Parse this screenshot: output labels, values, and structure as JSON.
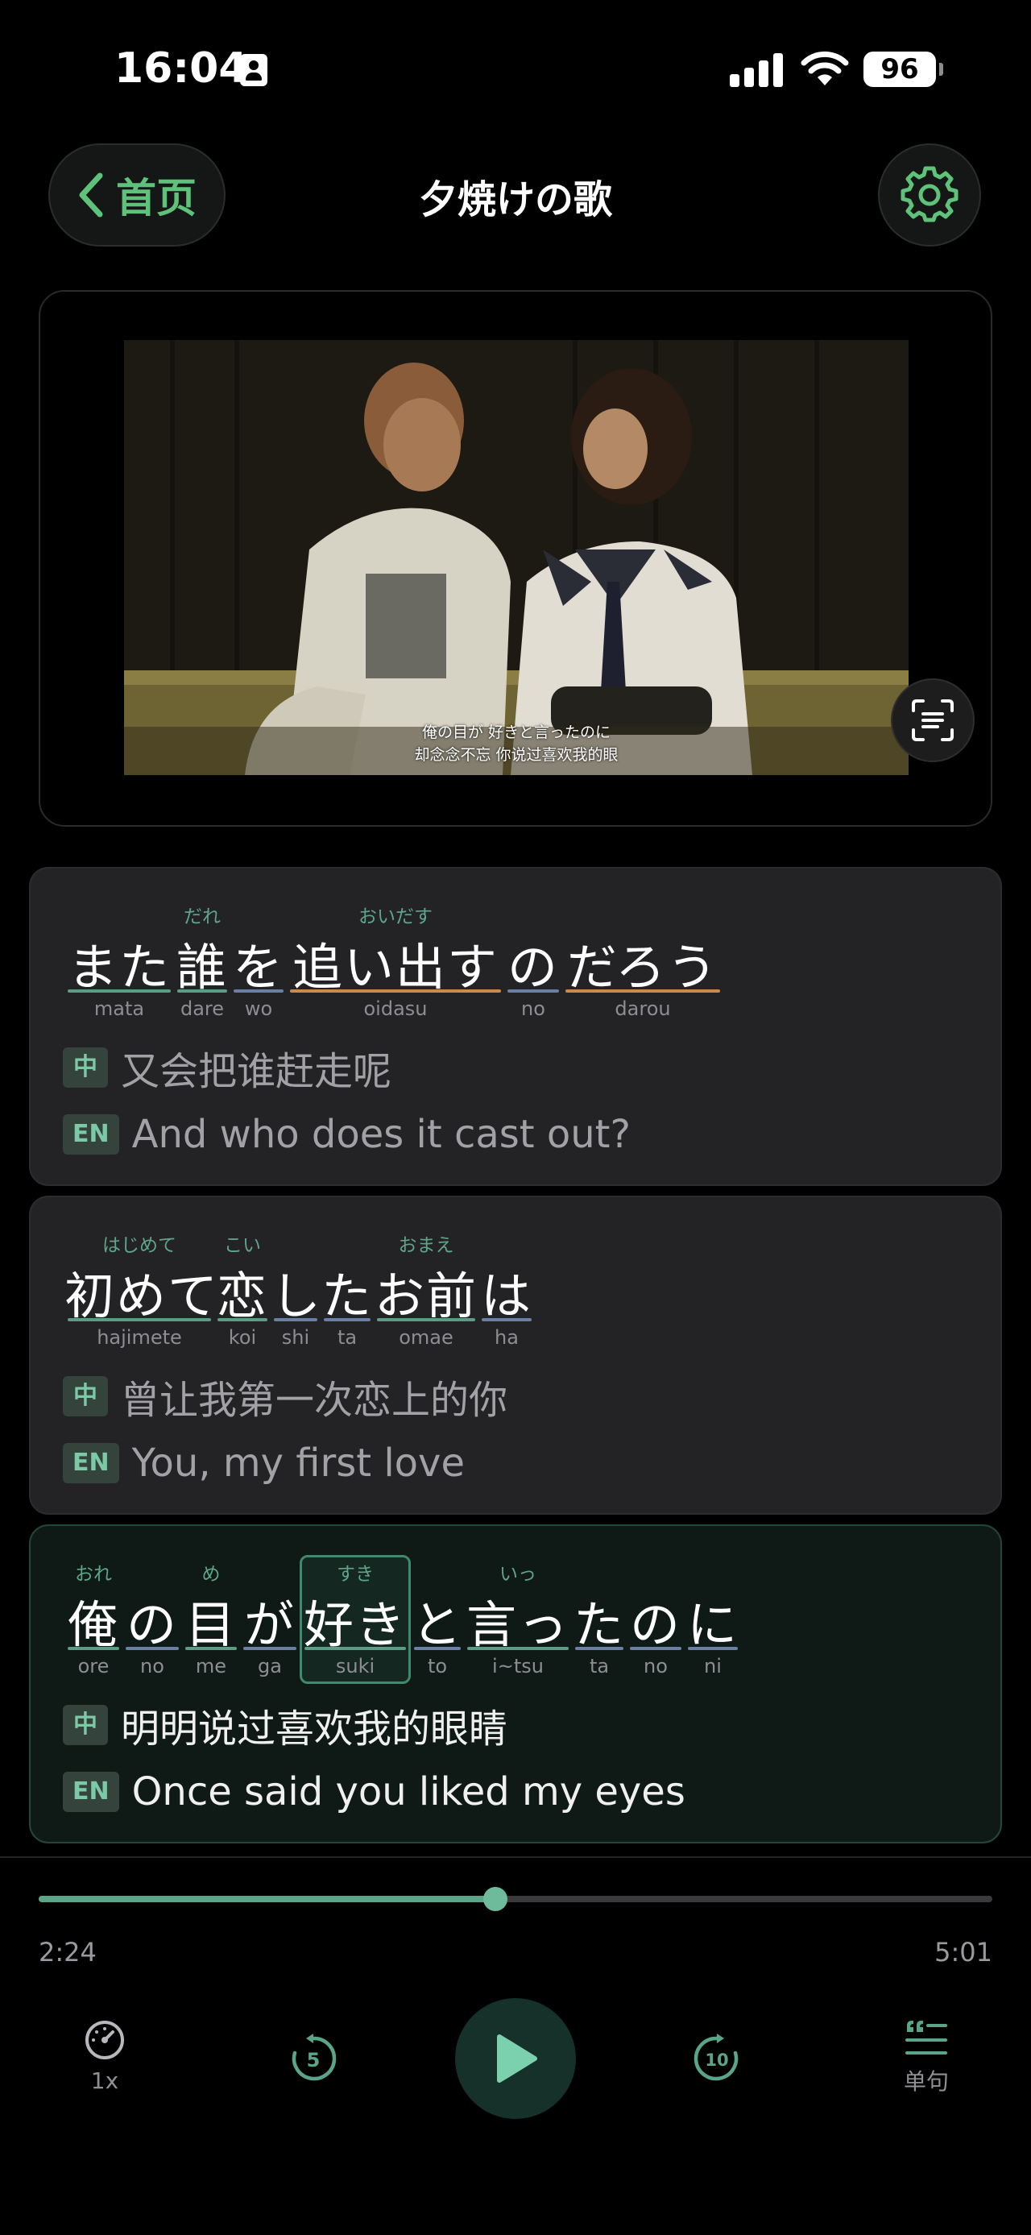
{
  "status_bar": {
    "time": "16:04",
    "battery": "96"
  },
  "header": {
    "back_label": "首页",
    "title": "夕焼けの歌"
  },
  "video": {
    "subtitle_jp": "俺の目が 好きと言ったのに",
    "subtitle_cn": "却念念不忘 你说过喜欢我的眼"
  },
  "lyrics": [
    {
      "words": [
        {
          "furigana": "",
          "text": "また",
          "romaji": "mata",
          "underline": "#5a9d82"
        },
        {
          "furigana": "だれ",
          "text": "誰",
          "romaji": "dare",
          "underline": "#5a9d82"
        },
        {
          "furigana": "",
          "text": "を",
          "romaji": "wo",
          "underline": "#6a7fa6"
        },
        {
          "furigana": "おいだす",
          "text": "追い出す",
          "romaji": "oidasu",
          "underline": "#c98a4e"
        },
        {
          "furigana": "",
          "text": "の",
          "romaji": "no",
          "underline": "#6a7fa6"
        },
        {
          "furigana": "",
          "text": "だろう",
          "romaji": "darou",
          "underline": "#c98a4e"
        }
      ],
      "zh_tag": "中",
      "zh": "又会把谁赶走呢",
      "en_tag": "EN",
      "en": "And who does it cast out?"
    },
    {
      "words": [
        {
          "furigana": "はじめて",
          "text": "初めて",
          "romaji": "hajimete",
          "underline": "#5a9d82"
        },
        {
          "furigana": "こい",
          "text": "恋",
          "romaji": "koi",
          "underline": "#5a9d82"
        },
        {
          "furigana": "",
          "text": "し",
          "romaji": "shi",
          "underline": "#6a7fa6"
        },
        {
          "furigana": "",
          "text": "た",
          "romaji": "ta",
          "underline": "#6a7fa6"
        },
        {
          "furigana": "おまえ",
          "text": "お前",
          "romaji": "omae",
          "underline": "#5a9d82"
        },
        {
          "furigana": "",
          "text": "は",
          "romaji": "ha",
          "underline": "#6a7fa6"
        }
      ],
      "zh_tag": "中",
      "zh": "曾让我第一次恋上的你",
      "en_tag": "EN",
      "en": "You, my first love"
    },
    {
      "words": [
        {
          "furigana": "おれ",
          "text": "俺",
          "romaji": "ore",
          "underline": "#5a9d82"
        },
        {
          "furigana": "",
          "text": "の",
          "romaji": "no",
          "underline": "#6a7fa6"
        },
        {
          "furigana": "め",
          "text": "目",
          "romaji": "me",
          "underline": "#5a9d82"
        },
        {
          "furigana": "",
          "text": "が",
          "romaji": "ga",
          "underline": "#6a7fa6"
        },
        {
          "furigana": "すき",
          "text": "好き",
          "romaji": "suki",
          "underline": "#5a9d82",
          "selected": true
        },
        {
          "furigana": "",
          "text": "と",
          "romaji": "to",
          "underline": "#6a7fa6"
        },
        {
          "furigana": "いっ",
          "text": "言っ",
          "romaji": "i~tsu",
          "underline": "#5a9d82"
        },
        {
          "furigana": "",
          "text": "た",
          "romaji": "ta",
          "underline": "#6a7fa6"
        },
        {
          "furigana": "",
          "text": "の",
          "romaji": "no",
          "underline": "#6a7fa6"
        },
        {
          "furigana": "",
          "text": "に",
          "romaji": "ni",
          "underline": "#6a7fa6"
        }
      ],
      "zh_tag": "中",
      "zh": "明明说过喜欢我的眼睛",
      "en_tag": "EN",
      "en": "Once said you liked my eyes",
      "active": true
    }
  ],
  "player": {
    "current_time": "2:24",
    "total_time": "5:01",
    "progress": 0.479,
    "speed_label": "1x",
    "rewind_seconds": "5",
    "forward_seconds": "10",
    "mode_label": "单句"
  },
  "colors": {
    "accent": "#5ec27a",
    "progress": "#5aa588",
    "background": "#000000"
  }
}
